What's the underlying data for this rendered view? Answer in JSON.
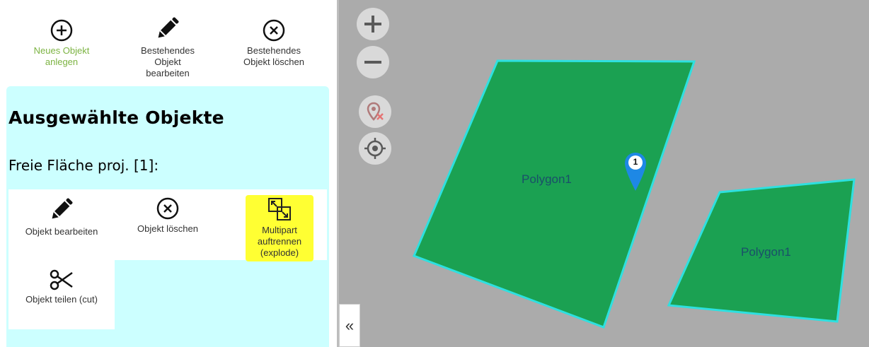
{
  "toolbar": {
    "new_object": "Neues Objekt anlegen",
    "edit_object": "Bestehendes Objekt bearbeiten",
    "delete_object": "Bestehendes Objekt löschen"
  },
  "panel": {
    "title": "Ausgewählte Objekte",
    "selection_label": "Freie Fläche proj. [1]:",
    "actions": {
      "edit": "Objekt bearbeiten",
      "delete": "Objekt löschen",
      "explode": "Multipart auftrennen (explode)",
      "cut": "Objekt teilen (cut)"
    }
  },
  "map": {
    "polygons": [
      {
        "label": "Polygon1"
      },
      {
        "label": "Polygon1"
      }
    ],
    "marker_number": "1",
    "collapse_glyph": "«",
    "colors": {
      "background": "#ababab",
      "polygon_fill": "#1ba152",
      "polygon_stroke": "#2ee0e0",
      "marker": "#1e88e5",
      "highlight": "#ffff33"
    }
  }
}
